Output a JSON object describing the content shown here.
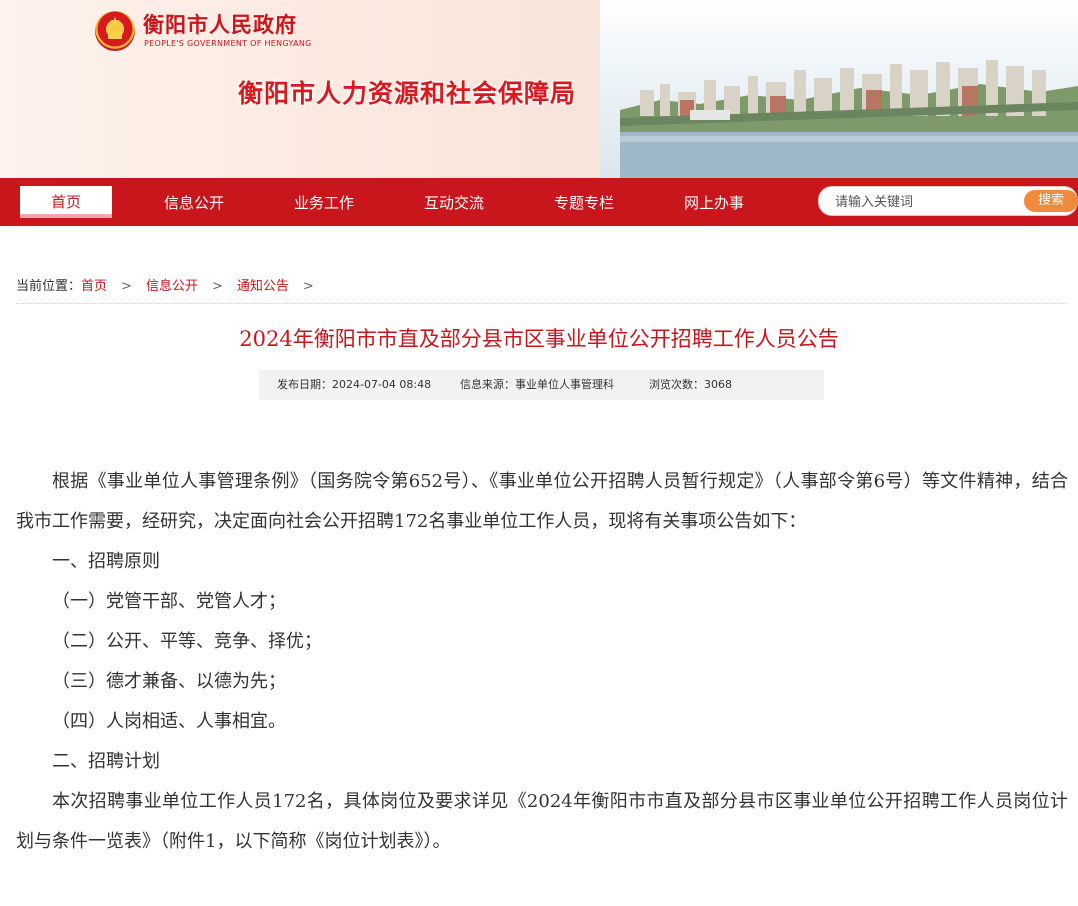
{
  "header": {
    "gov_name": "衡阳市人民政府",
    "gov_name_en": "PEOPLE'S GOVERNMENT OF HENGYANG",
    "bureau_name": "衡阳市人力资源和社会保障局"
  },
  "nav": {
    "items": [
      "首页",
      "信息公开",
      "业务工作",
      "互动交流",
      "专题专栏",
      "网上办事"
    ],
    "active": "首页",
    "search_placeholder": "请输入关键词",
    "search_button": "搜索"
  },
  "breadcrumb": {
    "prefix": "当前位置：",
    "items": [
      "首页",
      "信息公开",
      "通知公告"
    ],
    "separator": ">"
  },
  "article": {
    "title": "2024年衡阳市市直及部分县市区事业单位公开招聘工作人员公告",
    "meta": {
      "date": "发布日期：2024-07-04 08:48",
      "source": "信息来源：事业单位人事管理科",
      "views": "浏览次数：3068"
    },
    "paragraphs": [
      "根据《事业单位人事管理条例》（国务院令第652号）、《事业单位公开招聘人员暂行规定》（人事部令第6号）等文件精神，结合我市工作需要，经研究，决定面向社会公开招聘172名事业单位工作人员，现将有关事项公告如下：",
      "一、招聘原则",
      "（一）党管干部、党管人才；",
      "（二）公开、平等、竞争、择优；",
      "（三）德才兼备、以德为先；",
      "（四）人岗相适、人事相宜。",
      "二、招聘计划",
      "本次招聘事业单位工作人员172名，具体岗位及要求详见《2024年衡阳市市直及部分县市区事业单位公开招聘工作人员岗位计划与条件一览表》（附件1，以下简称《岗位计划表》）。"
    ]
  },
  "colors": {
    "brand_red": "#c9161c",
    "search_orange": "#f08a3c",
    "meta_bg": "#f2f2f2"
  }
}
